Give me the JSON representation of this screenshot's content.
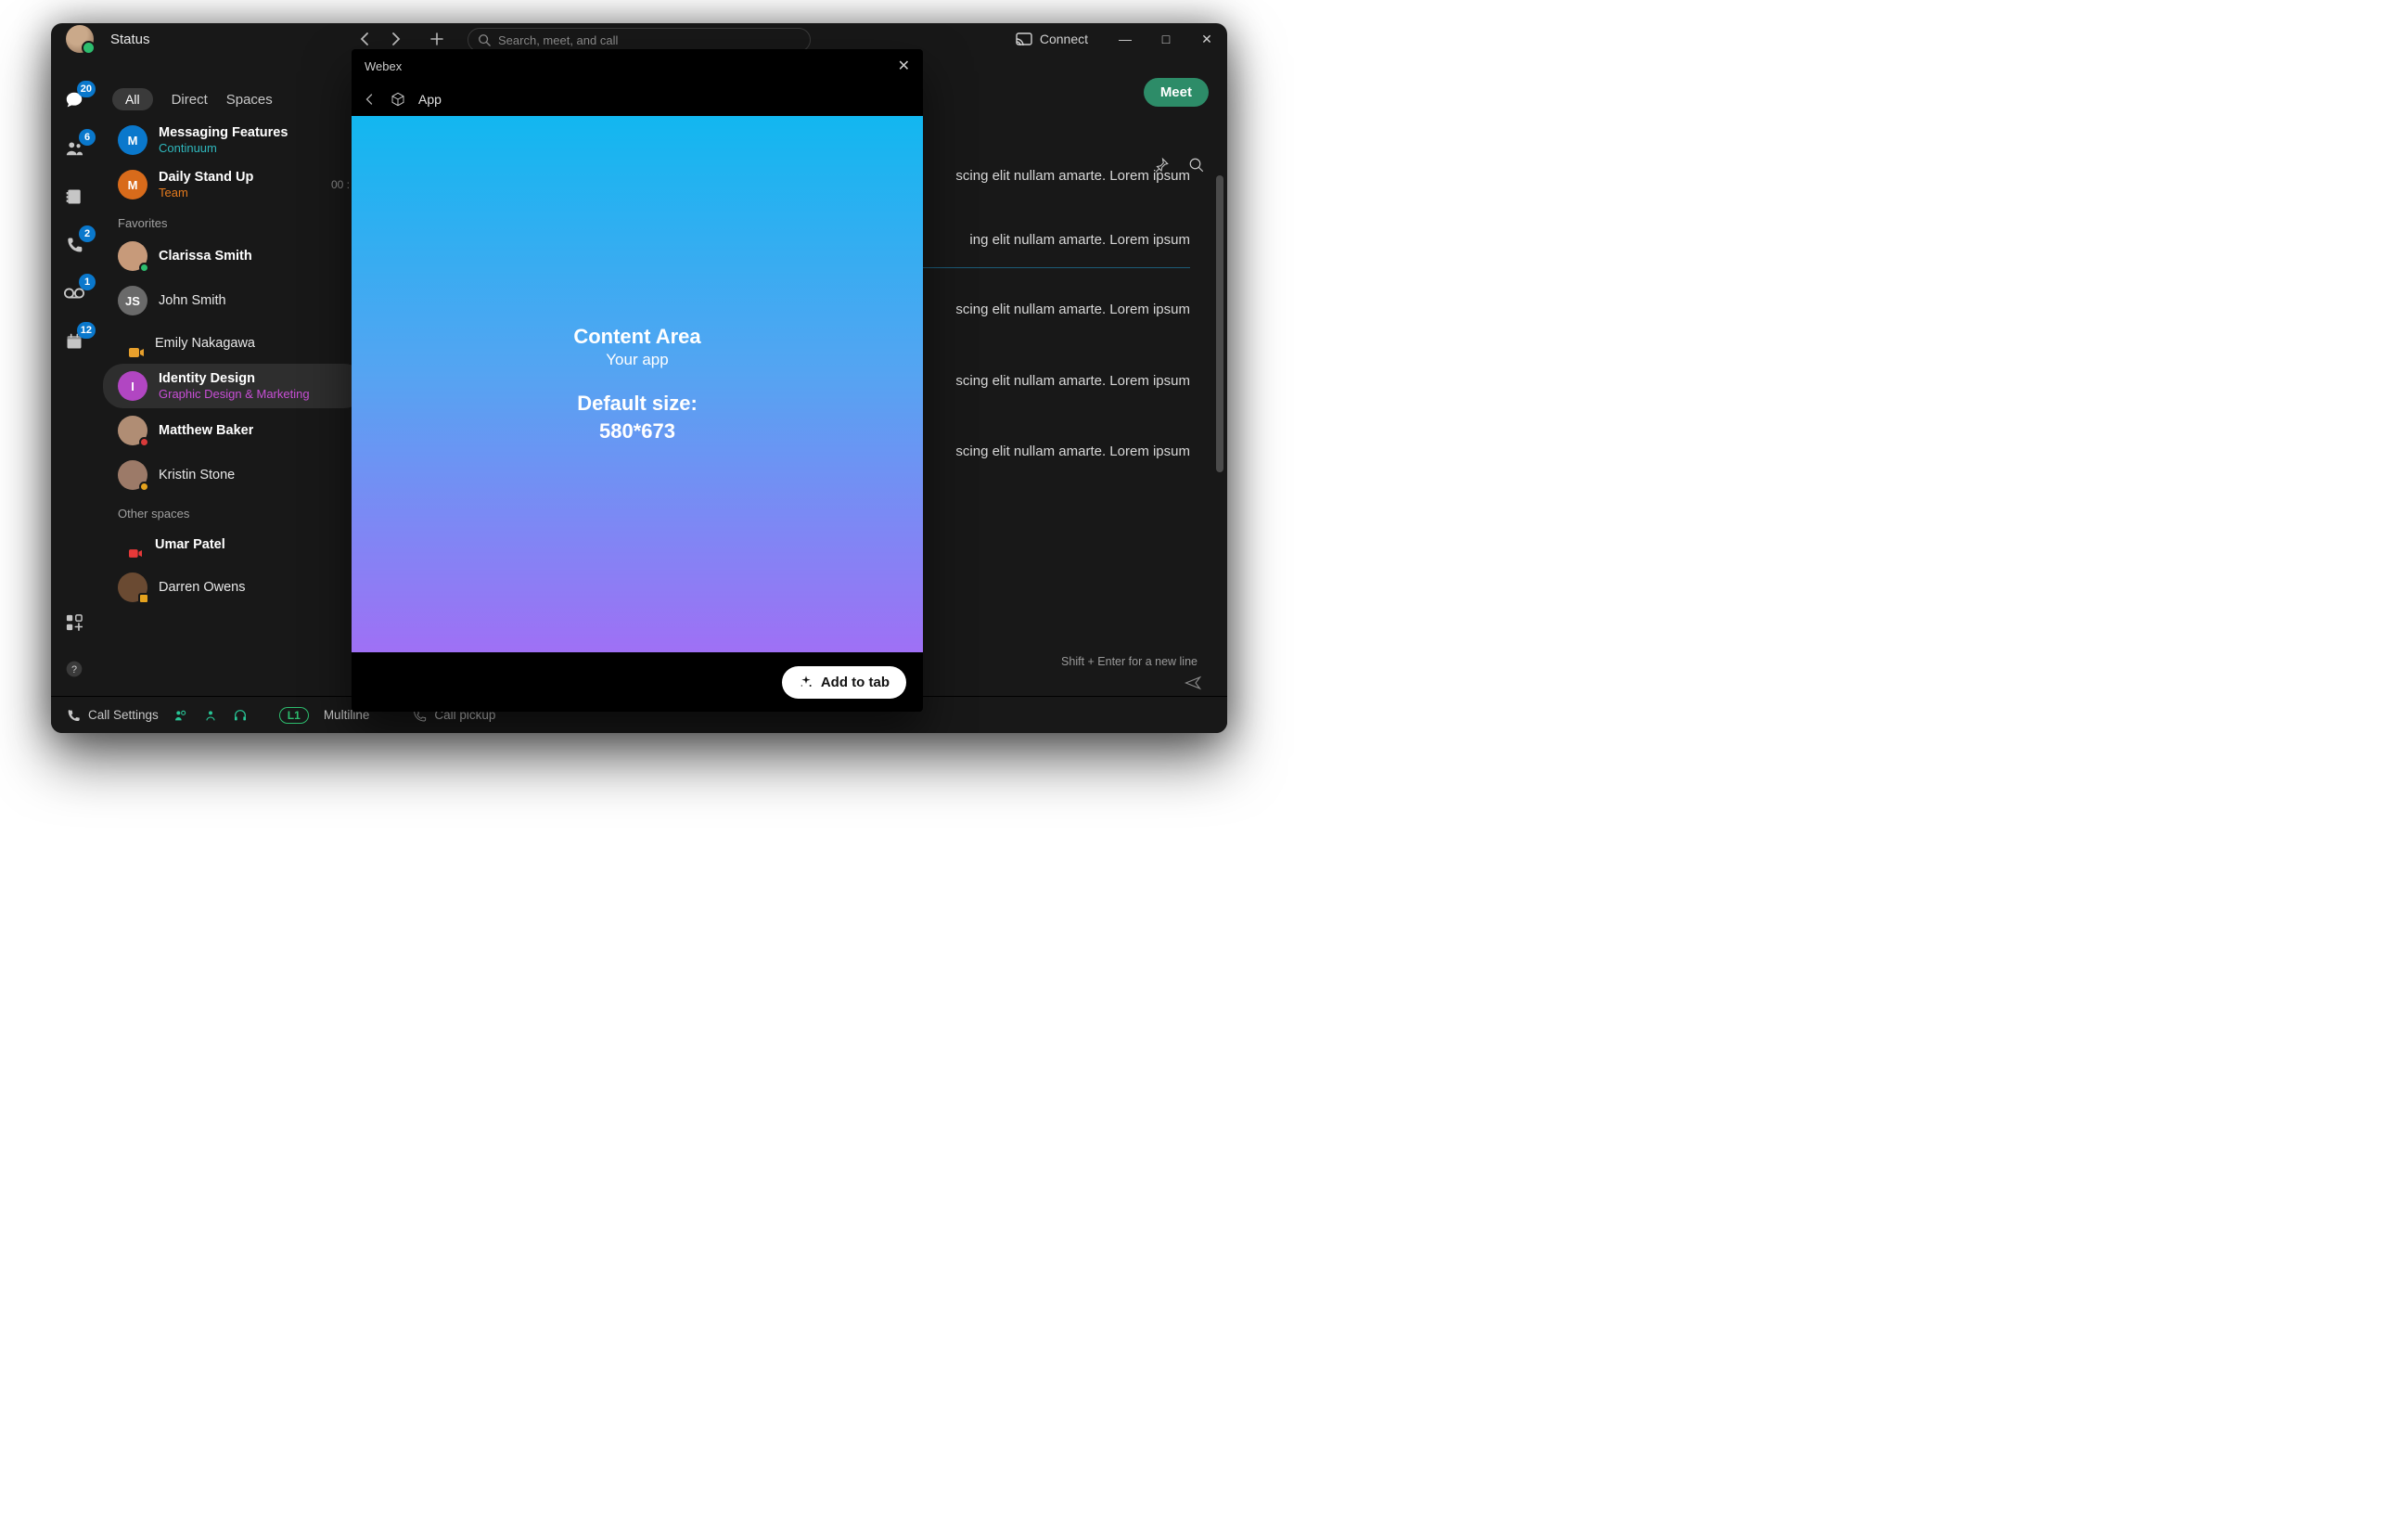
{
  "titlebar": {
    "status_label": "Status",
    "search_placeholder": "Search, meet, and call",
    "connect_label": "Connect"
  },
  "win_controls": {
    "min": "—",
    "max": "□",
    "close": "✕"
  },
  "nav": {
    "back": "‹",
    "forward": "›",
    "plus": "+"
  },
  "rail": {
    "messaging_badge": "20",
    "contacts_badge": "6",
    "calls_badge": "2",
    "voicemail_badge": "1",
    "calendar_badge": "12"
  },
  "filters": {
    "all": "All",
    "direct": "Direct",
    "spaces": "Spaces"
  },
  "rows": [
    {
      "avatar_letter": "M",
      "avatar_color": "#0a78cc",
      "title": "Messaging Features",
      "sub": "Continuum",
      "sub_color": "#2fb8bd",
      "time": ""
    },
    {
      "avatar_letter": "M",
      "avatar_color": "#d86b1b",
      "title": "Daily Stand Up",
      "sub": "Team",
      "sub_color": "#e57b1e",
      "time": "00 :"
    }
  ],
  "favorites_label": "Favorites",
  "favorites": [
    {
      "name": "Clarissa Smith",
      "bold": true,
      "presence": "green",
      "avatar": "#c79a7a"
    },
    {
      "name": "John Smith",
      "bold": false,
      "initials": "JS",
      "avatar": "#6a6a6a"
    },
    {
      "name": "Emily Nakagawa",
      "bold": false,
      "rec": true,
      "avatar": ""
    },
    {
      "name": "Identity Design",
      "bold": true,
      "sub": "Graphic Design & Marketing",
      "sub_color": "#c84fd6",
      "avatar": "#b146c2",
      "initials": "I",
      "selected": true
    },
    {
      "name": "Matthew Baker",
      "bold": true,
      "presence": "dnd",
      "avatar": "#b08d74"
    },
    {
      "name": "Kristin Stone",
      "bold": false,
      "presence": "away",
      "avatar": "#9c7a68"
    }
  ],
  "other_label": "Other spaces",
  "other": [
    {
      "name": "Umar Patel",
      "bold": true,
      "rec": true,
      "avatar": ""
    },
    {
      "name": "Darren Owens",
      "bold": false,
      "lock": true,
      "avatar": "#6a4a32"
    }
  ],
  "main": {
    "meet_label": "Meet",
    "msg_partial_1": "scing elit nullam amarte. Lorem ipsum",
    "msg_partial_2": "ing elit nullam amarte. Lorem ipsum",
    "msg_partial_3": "scing elit nullam amarte. Lorem ipsum",
    "msg_partial_4": "scing elit nullam amarte. Lorem ipsum",
    "msg_partial_5": "scing elit nullam amarte. Lorem ipsum",
    "compose_hint": "Shift + Enter for a new line"
  },
  "bottombar": {
    "call_settings": "Call Settings",
    "l1_badge": "L1",
    "multiline": "Multiline",
    "call_pickup": "Call pickup"
  },
  "modal": {
    "title": "Webex",
    "app_label": "App",
    "content_title": "Content Area",
    "content_sub": "Your app",
    "default_size_label": "Default size:",
    "default_size_value": "580*673",
    "add_to_tab": "Add to tab"
  }
}
